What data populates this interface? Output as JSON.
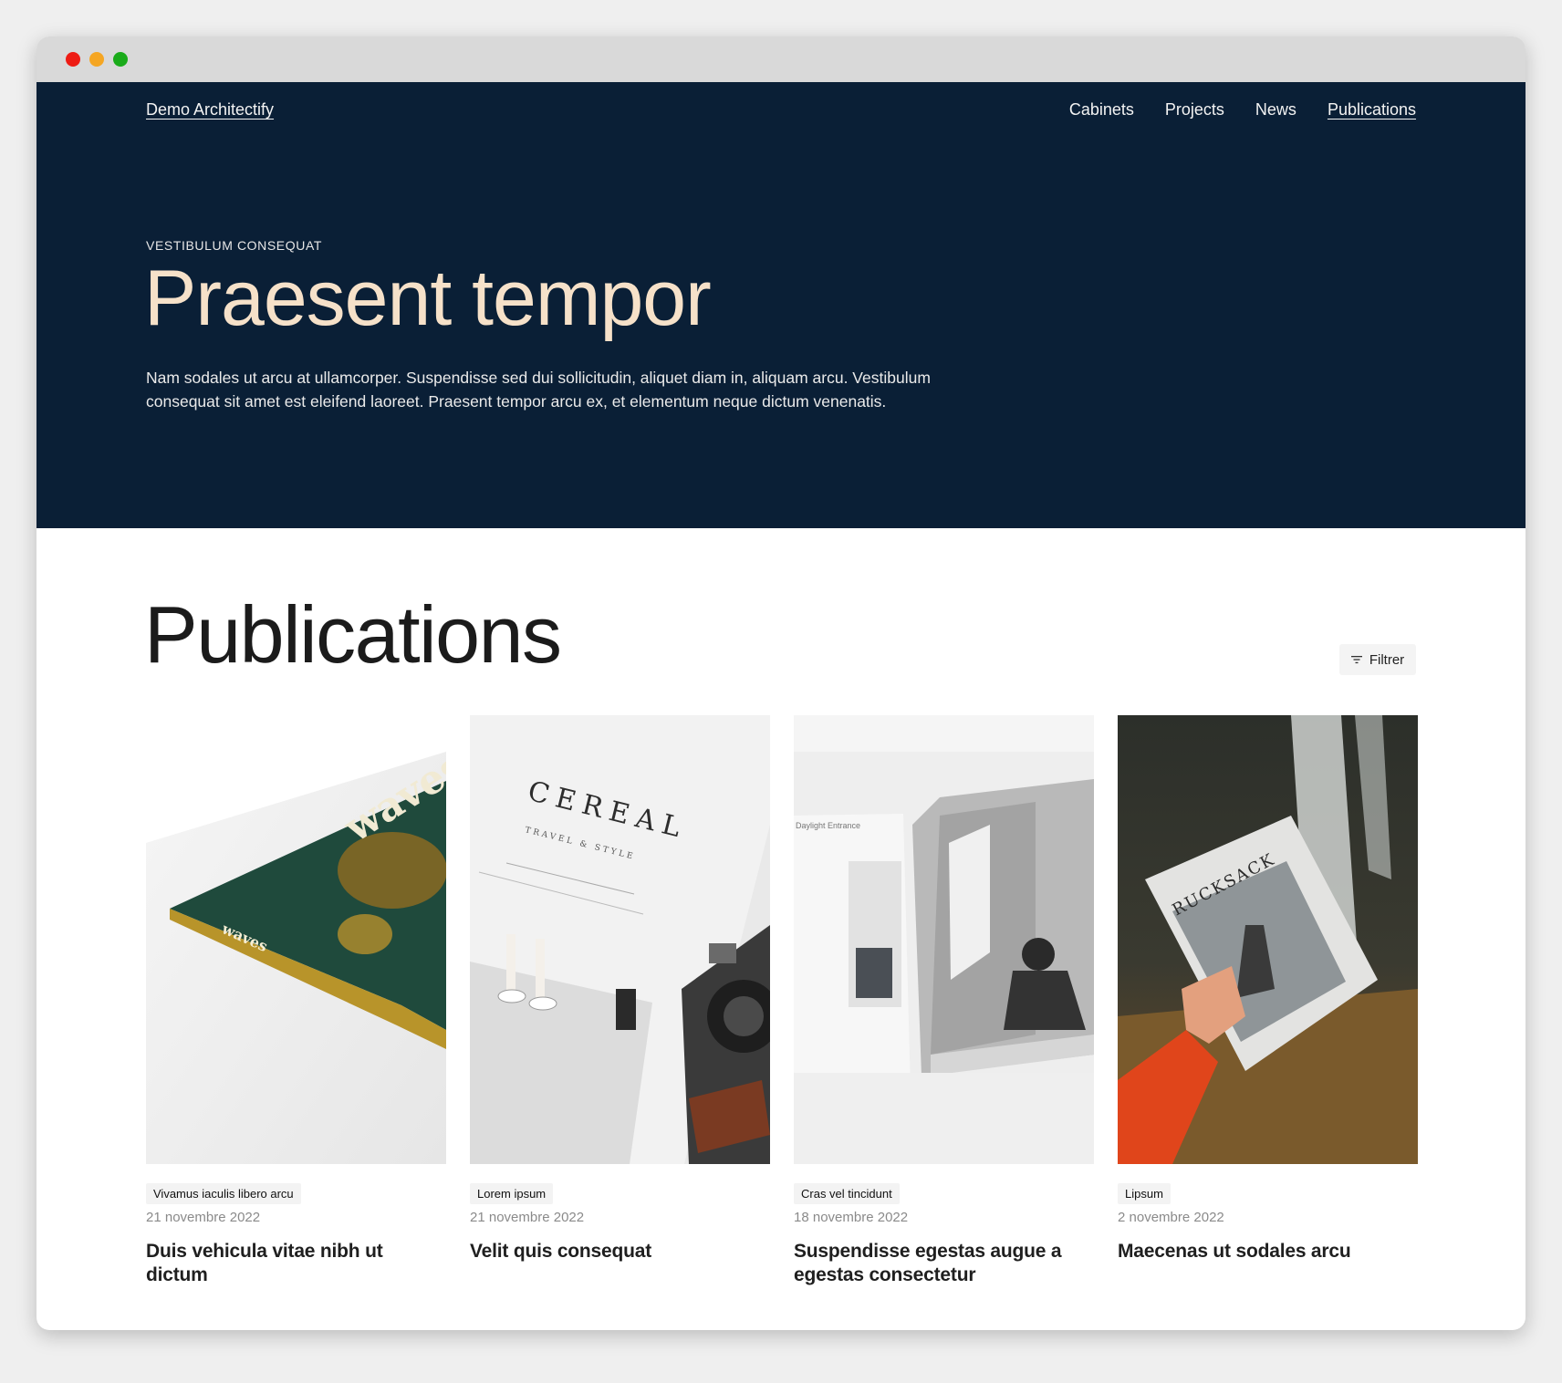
{
  "site": {
    "brand": "Demo Architectify",
    "nav": [
      "Cabinets",
      "Projects",
      "News",
      "Publications"
    ],
    "active_nav": "Publications"
  },
  "hero": {
    "eyebrow": "VESTIBULUM CONSEQUAT",
    "title": "Praesent tempor",
    "text": "Nam sodales ut arcu at ullamcorper. Suspendisse sed dui sollicitudin, aliquet diam in, aliquam arcu. Vestibulum consequat sit amet est eleifend laoreet. Praesent tempor arcu ex, et elementum neque dictum venenatis."
  },
  "main": {
    "title": "Publications",
    "filter_label": "Filtrer",
    "cards": [
      {
        "tag": "Vivamus iaculis libero arcu",
        "date": "21 novembre 2022",
        "title": "Duis vehicula vitae nibh ut dictum",
        "image": "magazine-waves-photo"
      },
      {
        "tag": "Lorem ipsum",
        "date": "21 novembre 2022",
        "title": "Velit quis consequat",
        "image": "magazine-cereal-camera-photo"
      },
      {
        "tag": "Cras vel tincidunt",
        "date": "18 novembre 2022",
        "title": "Suspendisse egestas augue a egestas consectetur",
        "image": "open-magazine-architecture-photo"
      },
      {
        "tag": "Lipsum",
        "date": "2 novembre 2022",
        "title": "Maecenas ut sodales arcu",
        "image": "rucksack-magazine-waterfall-photo"
      }
    ]
  },
  "colors": {
    "hero_bg": "#0a1f36",
    "hero_title": "#f6e1c9"
  }
}
